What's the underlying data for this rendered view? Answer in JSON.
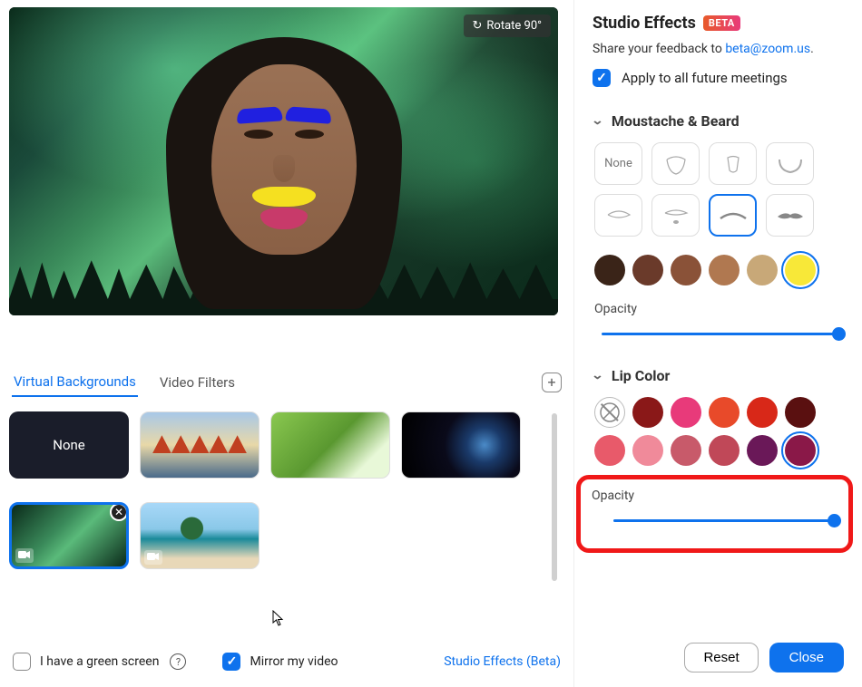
{
  "preview": {
    "rotate_label": "Rotate 90°"
  },
  "tabs": {
    "virtual_backgrounds": "Virtual Backgrounds",
    "video_filters": "Video Filters"
  },
  "backgrounds": {
    "none_label": "None"
  },
  "bottom": {
    "green_screen_label": "I have a green screen",
    "mirror_label": "Mirror my video",
    "studio_effects_link": "Studio Effects (Beta)"
  },
  "panel": {
    "title": "Studio Effects",
    "beta": "BETA",
    "feedback_prefix": "Share your feedback to  ",
    "feedback_email": "beta@zoom.us",
    "apply_label": "Apply to all future meetings"
  },
  "sections": {
    "moustache": {
      "title": "Moustache & Beard",
      "none_label": "None",
      "opacity_label": "Opacity",
      "opacity_value": 100,
      "colors": [
        "#3a2418",
        "#6a3a2a",
        "#8a5238",
        "#b07850",
        "#c8a878",
        "#f8e838"
      ],
      "selected_color_index": 5,
      "selected_style_index": 6
    },
    "lip": {
      "title": "Lip Color",
      "opacity_label": "Opacity",
      "opacity_value": 100,
      "colors_row1": [
        "none",
        "#8a1818",
        "#e83a7a",
        "#e84a2a",
        "#d82818",
        "#5a1010"
      ],
      "colors_row2": [
        "#e85a6a",
        "#f08a9a",
        "#c85a6a",
        "#c04858",
        "#6a1858",
        "#8a1848"
      ],
      "selected_index": 11
    }
  },
  "buttons": {
    "reset": "Reset",
    "close": "Close"
  }
}
